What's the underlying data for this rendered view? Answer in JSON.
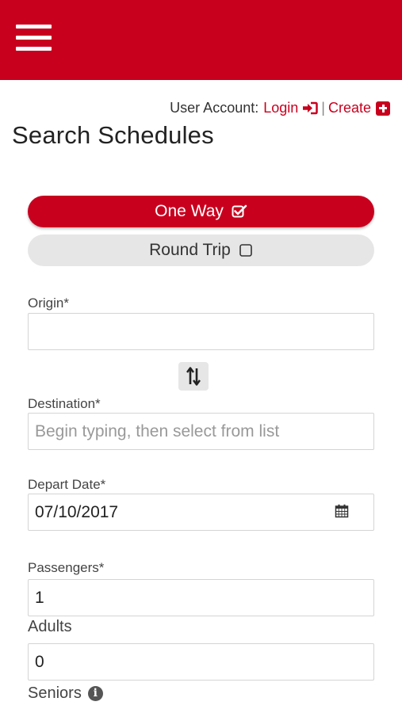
{
  "header": {
    "menu_icon": "hamburger-menu-icon",
    "brand_color": "#c8001e"
  },
  "account": {
    "prefix": "User Account:",
    "login_label": "Login",
    "separator": "|",
    "create_label": "Create"
  },
  "page_title": "Search Schedules",
  "trip_type": {
    "one_way_label": "One Way",
    "one_way_checked": true,
    "round_trip_label": "Round Trip",
    "round_trip_checked": false
  },
  "origin": {
    "label": "Origin*",
    "value": "",
    "placeholder": ""
  },
  "swap_icon": "swap-direction-icon",
  "destination": {
    "label": "Destination*",
    "value": "",
    "placeholder": "Begin typing, then select from list"
  },
  "depart_date": {
    "label": "Depart Date*",
    "value": "07/10/2017"
  },
  "passengers": {
    "label": "Passengers*",
    "adults_value": "1",
    "adults_label": "Adults",
    "seniors_value": "0",
    "seniors_label": "Seniors"
  }
}
